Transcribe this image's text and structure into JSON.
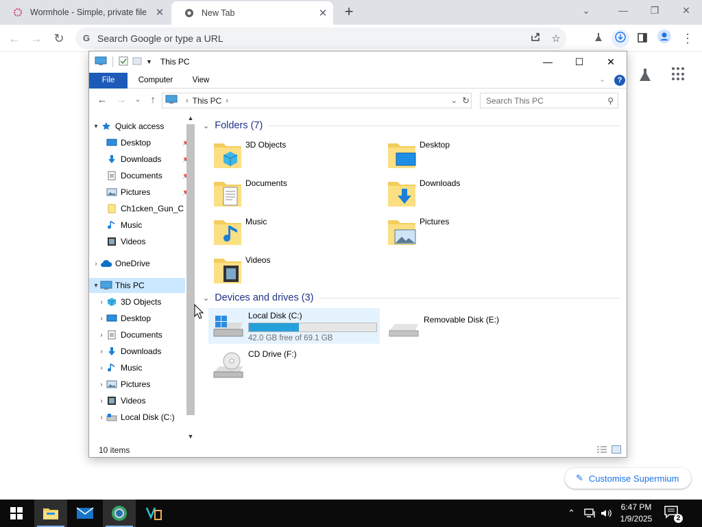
{
  "browser": {
    "tabs": [
      {
        "title": "Wormhole - Simple, private file",
        "close": "✕",
        "active": false
      },
      {
        "title": "New Tab",
        "close": "✕",
        "active": true
      }
    ],
    "new_tab": "+",
    "window_controls": {
      "dropdown": "⌄",
      "minimize": "—",
      "restore": "❐",
      "close": "✕"
    },
    "omnibox": {
      "placeholder": "Search Google or type a URL",
      "g_letter": "G"
    },
    "customise_label": "Customise Supermium",
    "icons": [
      "back-icon",
      "forward-icon",
      "reload-icon",
      "share-icon",
      "star-icon",
      "flask-icon",
      "download-icon",
      "sidepanel-icon",
      "profile-icon",
      "menu-icon",
      "apps-grid-icon",
      "pencil-icon"
    ],
    "accent": "#1a73e8"
  },
  "explorer": {
    "title": "This PC",
    "ribbon_tabs": [
      "File",
      "Computer",
      "View"
    ],
    "help": "?",
    "address": {
      "location": "This PC",
      "separator": "›"
    },
    "search_placeholder": "Search This PC",
    "nav": {
      "quick_access": "Quick access",
      "quick_items": [
        {
          "label": "Desktop",
          "icon": "desktop-icon",
          "pinned": true
        },
        {
          "label": "Downloads",
          "icon": "downloads-icon",
          "pinned": true
        },
        {
          "label": "Documents",
          "icon": "documents-icon",
          "pinned": true
        },
        {
          "label": "Pictures",
          "icon": "pictures-icon",
          "pinned": true
        },
        {
          "label": "Ch1cken_Gun_C",
          "icon": "folder-icon",
          "pinned": false
        },
        {
          "label": "Music",
          "icon": "music-icon",
          "pinned": false
        },
        {
          "label": "Videos",
          "icon": "videos-icon",
          "pinned": false
        }
      ],
      "onedrive": "OneDrive",
      "this_pc": "This PC",
      "pc_items": [
        {
          "label": "3D Objects",
          "icon": "3d-objects-icon"
        },
        {
          "label": "Desktop",
          "icon": "desktop-icon"
        },
        {
          "label": "Documents",
          "icon": "documents-icon"
        },
        {
          "label": "Downloads",
          "icon": "downloads-icon"
        },
        {
          "label": "Music",
          "icon": "music-icon"
        },
        {
          "label": "Pictures",
          "icon": "pictures-icon"
        },
        {
          "label": "Videos",
          "icon": "videos-icon"
        },
        {
          "label": "Local Disk (C:)",
          "icon": "local-disk-icon"
        }
      ]
    },
    "folders_header": "Folders (7)",
    "folders": [
      {
        "label": "3D Objects",
        "icon": "3d-objects-folder-icon"
      },
      {
        "label": "Desktop",
        "icon": "desktop-folder-icon"
      },
      {
        "label": "Documents",
        "icon": "documents-folder-icon"
      },
      {
        "label": "Downloads",
        "icon": "downloads-folder-icon"
      },
      {
        "label": "Music",
        "icon": "music-folder-icon"
      },
      {
        "label": "Pictures",
        "icon": "pictures-folder-icon"
      },
      {
        "label": "Videos",
        "icon": "videos-folder-icon"
      }
    ],
    "drives_header": "Devices and drives (3)",
    "drives": [
      {
        "label": "Local Disk (C:)",
        "free_text": "42.0 GB free of 69.1 GB",
        "used_fraction": 0.392,
        "selected": true
      },
      {
        "label": "Removable Disk (E:)"
      },
      {
        "label": "CD Drive (F:)"
      }
    ],
    "status_count": "10 items",
    "colors": {
      "file_tab": "#1e5bb8",
      "selection": "#cce8ff",
      "header_text": "#1e3287",
      "disk_bar": "#26a0da"
    }
  },
  "taskbar": {
    "items": [
      "start-icon",
      "file-explorer-icon",
      "mail-icon",
      "browser-icon",
      "visual-studio-icon"
    ],
    "clock_time": "6:47 PM",
    "clock_date": "1/9/2025",
    "notification_count": "2"
  }
}
